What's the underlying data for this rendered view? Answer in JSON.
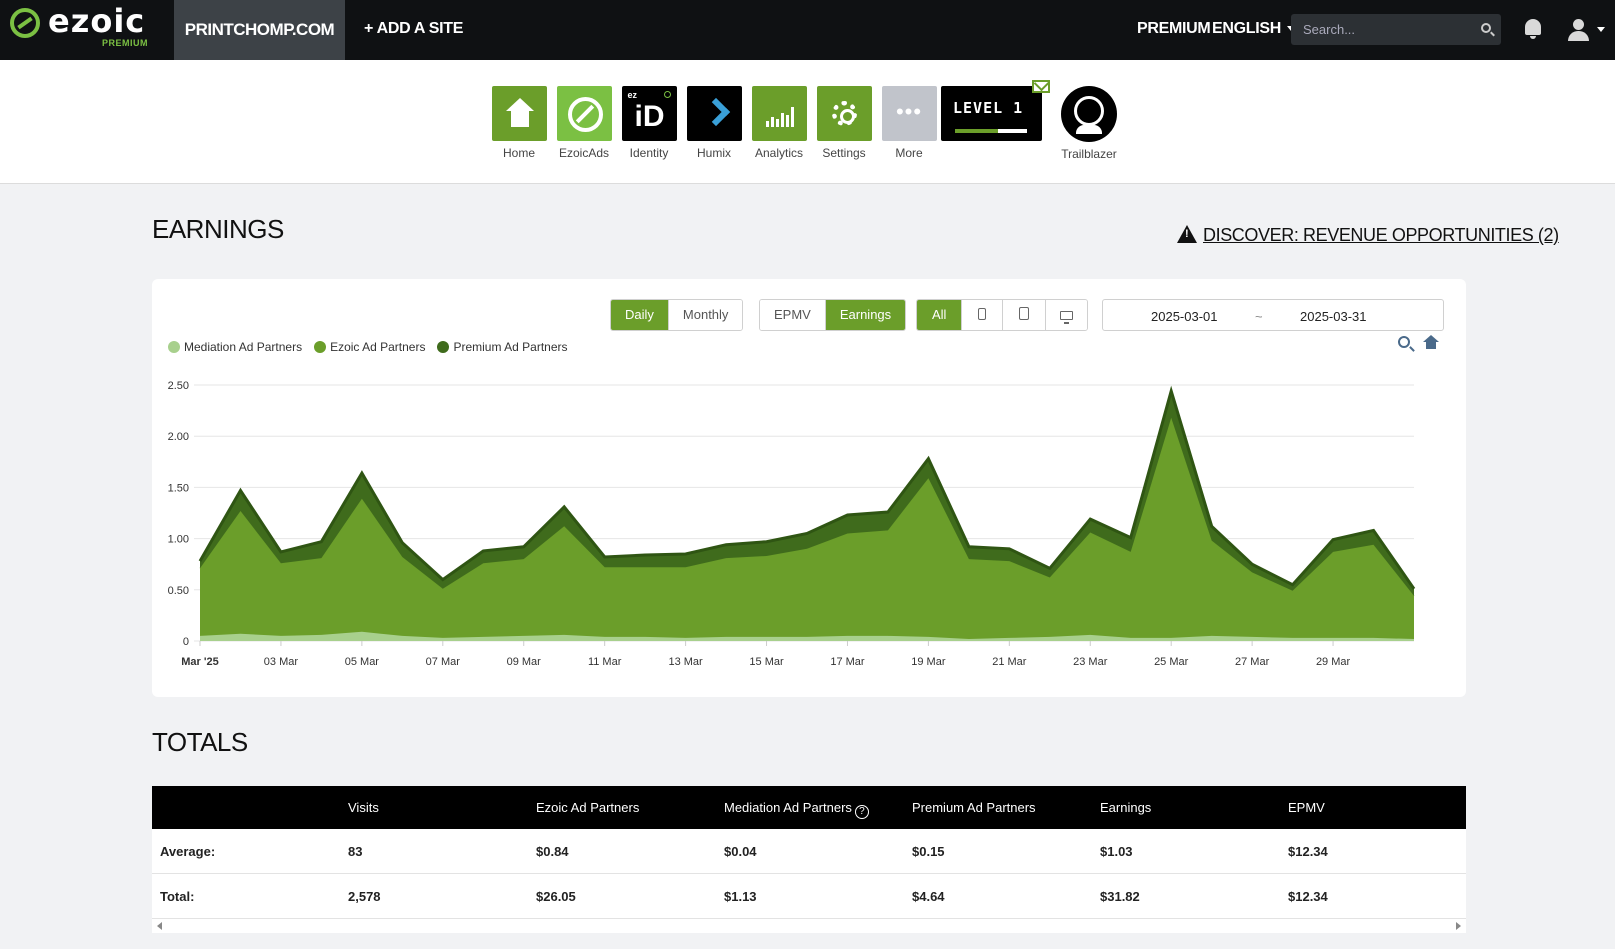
{
  "topbar": {
    "logo_text": "ezoic",
    "logo_sub": "PREMIUM",
    "site": "PRINTCHOMP.COM",
    "add_site": "+ ADD A SITE",
    "premium": "PREMIUM",
    "language": "ENGLISH",
    "search_placeholder": "Search..."
  },
  "apps": [
    {
      "label": "Home",
      "icon": "home-icon"
    },
    {
      "label": "EzoicAds",
      "icon": "ezoicads-icon"
    },
    {
      "label": "Identity",
      "icon": "identity-icon",
      "tile_text": "iD",
      "tile_sub": "ez"
    },
    {
      "label": "Humix",
      "icon": "humix-icon"
    },
    {
      "label": "Analytics",
      "icon": "analytics-icon"
    },
    {
      "label": "Settings",
      "icon": "gear-icon"
    },
    {
      "label": "More",
      "icon": "more-icon"
    }
  ],
  "level": {
    "text": "LEVEL 1",
    "progress": 0.6
  },
  "trailblazer": {
    "label": "Trailblazer"
  },
  "earnings": {
    "title": "EARNINGS",
    "discover": "DISCOVER: REVENUE OPPORTUNITIES (2)",
    "period_buttons": [
      "Daily",
      "Monthly"
    ],
    "metric_buttons": [
      "EPMV",
      "Earnings"
    ],
    "device_buttons": [
      "All"
    ],
    "date_start": "2025-03-01",
    "date_sep": "~",
    "date_end": "2025-03-31"
  },
  "chart_data": {
    "type": "area",
    "stacked": true,
    "x": [
      "2025-03-01",
      "2025-03-02",
      "2025-03-03",
      "2025-03-04",
      "2025-03-05",
      "2025-03-06",
      "2025-03-07",
      "2025-03-08",
      "2025-03-09",
      "2025-03-10",
      "2025-03-11",
      "2025-03-12",
      "2025-03-13",
      "2025-03-14",
      "2025-03-15",
      "2025-03-16",
      "2025-03-17",
      "2025-03-18",
      "2025-03-19",
      "2025-03-20",
      "2025-03-21",
      "2025-03-22",
      "2025-03-23",
      "2025-03-24",
      "2025-03-25",
      "2025-03-26",
      "2025-03-27",
      "2025-03-28",
      "2025-03-29",
      "2025-03-30",
      "2025-03-31"
    ],
    "tick_labels": [
      "Mar '25",
      "03 Mar",
      "05 Mar",
      "07 Mar",
      "09 Mar",
      "11 Mar",
      "13 Mar",
      "15 Mar",
      "17 Mar",
      "19 Mar",
      "21 Mar",
      "23 Mar",
      "25 Mar",
      "27 Mar",
      "29 Mar"
    ],
    "y_ticks": [
      "0",
      "0.50",
      "1.00",
      "1.50",
      "2.00",
      "2.50"
    ],
    "ylim": [
      0,
      2.5
    ],
    "legend_position": "top-left",
    "series": [
      {
        "name": "Mediation Ad Partners",
        "color": "#a8d08d",
        "values": [
          0.05,
          0.07,
          0.05,
          0.06,
          0.09,
          0.05,
          0.03,
          0.04,
          0.05,
          0.06,
          0.04,
          0.04,
          0.03,
          0.04,
          0.04,
          0.04,
          0.05,
          0.05,
          0.04,
          0.02,
          0.03,
          0.04,
          0.06,
          0.03,
          0.03,
          0.05,
          0.04,
          0.03,
          0.03,
          0.03,
          0.02
        ]
      },
      {
        "name": "Ezoic Ad Partners",
        "color": "#6b9e2a",
        "values": [
          0.66,
          1.2,
          0.71,
          0.75,
          1.3,
          0.77,
          0.48,
          0.72,
          0.75,
          1.06,
          0.68,
          0.68,
          0.69,
          0.77,
          0.79,
          0.86,
          1.0,
          1.03,
          1.55,
          0.78,
          0.75,
          0.58,
          1.0,
          0.84,
          2.15,
          0.93,
          0.63,
          0.46,
          0.84,
          0.91,
          0.42
        ]
      },
      {
        "name": "Premium Ad Partners",
        "color": "#3f6b1c",
        "values": [
          0.07,
          0.2,
          0.11,
          0.16,
          0.25,
          0.14,
          0.09,
          0.12,
          0.12,
          0.19,
          0.1,
          0.12,
          0.13,
          0.13,
          0.14,
          0.15,
          0.18,
          0.18,
          0.19,
          0.12,
          0.12,
          0.09,
          0.13,
          0.14,
          0.26,
          0.14,
          0.08,
          0.06,
          0.12,
          0.14,
          0.07
        ]
      }
    ]
  },
  "totals": {
    "title": "TOTALS",
    "headers": [
      "",
      "Visits",
      "Ezoic Ad Partners",
      "Mediation Ad Partners",
      "Premium Ad Partners",
      "Earnings",
      "EPMV"
    ],
    "help_glyph": "?",
    "rows": [
      [
        "Average:",
        "83",
        "$0.84",
        "$0.04",
        "$0.15",
        "$1.03",
        "$12.34"
      ],
      [
        "Total:",
        "2,578",
        "$26.05",
        "$1.13",
        "$4.64",
        "$31.82",
        "$12.34"
      ]
    ]
  }
}
